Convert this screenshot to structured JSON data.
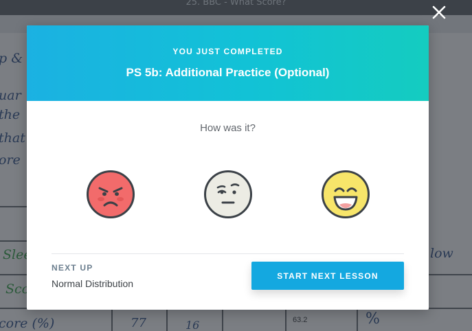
{
  "background": {
    "top_title": "25. BBC - What Score?",
    "table_values": [
      "77",
      "16",
      "63.2",
      "%"
    ]
  },
  "modal": {
    "completed_label": "YOU JUST COMPLETED",
    "lesson_title": "PS 5b: Additional Practice (Optional)",
    "question": "How was it?",
    "ratings": [
      {
        "icon": "angry-face-icon",
        "color": "#f26b6b"
      },
      {
        "icon": "neutral-face-icon",
        "color": "#ecece4"
      },
      {
        "icon": "happy-face-icon",
        "color": "#f7e56a"
      }
    ],
    "next_up": {
      "label": "NEXT UP",
      "lesson": "Normal Distribution"
    },
    "start_button": "START NEXT LESSON"
  },
  "colors": {
    "header_gradient_start": "#1bb1e2",
    "header_gradient_end": "#14ccc0",
    "button": "#14a8e0"
  }
}
